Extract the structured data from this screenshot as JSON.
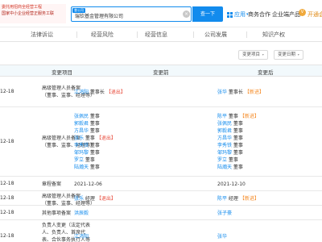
{
  "ad": {
    "line1": "委托用招商全经营工程",
    "line2": "国家中小企业经营正服务工联"
  },
  "search": {
    "tag": "查公司",
    "value": "瑞钦基金管理有限公司",
    "clear": "×",
    "button": "查一下"
  },
  "header": {
    "apps": "应用",
    "apps_caret": "▾",
    "link1": "商务合作",
    "link2": "企业端产品",
    "link2_caret": "▾",
    "vip_badge": "V",
    "vip": "开通会"
  },
  "tabs": [
    {
      "label": "法律诉讼"
    },
    {
      "label": "经营风险"
    },
    {
      "label": "经营信息"
    },
    {
      "label": "公司发展"
    },
    {
      "label": "知识产权"
    }
  ],
  "filters": {
    "item": "变更项目",
    "date": "变更日期",
    "caret": "▾"
  },
  "table": {
    "headers": {
      "item": "变更项目",
      "before": "变更前",
      "after": "变更后"
    },
    "rows": [
      {
        "date": "12-18",
        "item": [
          "高级管理人员备案",
          "（董事、监事、经理等）"
        ],
        "before": [
          {
            "name": "江鸿阳",
            "role": "董事长",
            "tag": "退出",
            "tagtype": "red"
          }
        ],
        "after": [
          {
            "name": "张华",
            "role": "董事长",
            "tag": "新进",
            "tagtype": "orange"
          }
        ]
      },
      {
        "date": "12-18",
        "item": [
          "高级管理人员备案",
          "（董事、监事、经理等）"
        ],
        "before": [
          {
            "name": "张佩民",
            "role": "董事"
          },
          {
            "name": "郭毅君",
            "role": "董事"
          },
          {
            "name": "方昌华",
            "role": "董事"
          },
          {
            "name": "张乐",
            "role": "董事",
            "tag": "退出",
            "tagtype": "red"
          },
          {
            "name": "李秀铁",
            "role": "董事"
          },
          {
            "name": "邹玛黎",
            "role": "董事"
          },
          {
            "name": "罗立",
            "role": "董事"
          },
          {
            "name": "陆瀚天",
            "role": "董事"
          }
        ],
        "after": [
          {
            "name": "陈平",
            "role": "董事",
            "tag": "新进",
            "tagtype": "orange"
          },
          {
            "name": "张佩民",
            "role": "董事"
          },
          {
            "name": "郭毅君",
            "role": "董事"
          },
          {
            "name": "方昌华",
            "role": "董事"
          },
          {
            "name": "李秀铁",
            "role": "董事"
          },
          {
            "name": "邹玛黎",
            "role": "董事"
          },
          {
            "name": "罗立",
            "role": "董事"
          },
          {
            "name": "陆瀚天",
            "role": "董事"
          }
        ]
      },
      {
        "date": "12-18",
        "item": [
          "章程备案"
        ],
        "before": [
          {
            "plain": "2021-12-06"
          }
        ],
        "after": [
          {
            "plain": "2021-12-10"
          }
        ]
      },
      {
        "date": "12-18",
        "item": [
          "高级管理人员备案",
          "（董事、监事、经理等）"
        ],
        "before": [
          {
            "name": "张乐",
            "role": "经理",
            "tag": "退出",
            "tagtype": "red"
          }
        ],
        "after": [
          {
            "name": "陈平",
            "role": "经理",
            "tag": "新进",
            "tagtype": "orange"
          }
        ]
      },
      {
        "date": "12-18",
        "item": [
          "其他事项备案"
        ],
        "before": [
          {
            "name": "洪辰毅"
          }
        ],
        "after": [
          {
            "name": "张子豪"
          }
        ]
      },
      {
        "date": "12-18",
        "item": [
          "负责人变更（法定代表",
          "人、负责人、首席代",
          "表、合伙事务执行人等",
          "变更）"
        ],
        "before": [
          {
            "name": "江鸿阳"
          }
        ],
        "after": [
          {
            "name": "张华"
          }
        ]
      }
    ]
  }
}
